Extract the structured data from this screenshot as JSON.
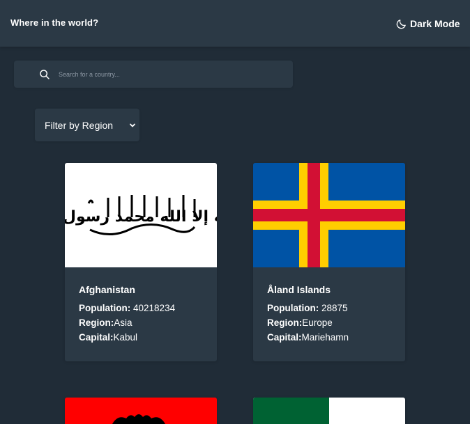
{
  "header": {
    "title": "Where in the world?",
    "theme_toggle_label": "Dark Mode",
    "theme_icon": "moon-icon"
  },
  "search": {
    "placeholder": "Search for a country...",
    "value": "",
    "icon": "search-icon"
  },
  "filter": {
    "label": "Filter by Region",
    "icon": "chevron-down-icon"
  },
  "countries": [
    {
      "name": "Afghanistan",
      "population_label": "Population:",
      "population": "40218234",
      "region_label": "Region:",
      "region": "Asia",
      "capital_label": "Capital:",
      "capital": "Kabul",
      "flag_inscription": "لا إله إلا الله محمد رسول الله"
    },
    {
      "name": "Åland Islands",
      "population_label": "Population:",
      "population": "28875",
      "region_label": "Region:",
      "region": "Europe",
      "capital_label": "Capital:",
      "capital": "Mariehamn"
    }
  ],
  "colors": {
    "background": "#202c37",
    "surface": "#2b3945",
    "text": "#ffffff"
  }
}
